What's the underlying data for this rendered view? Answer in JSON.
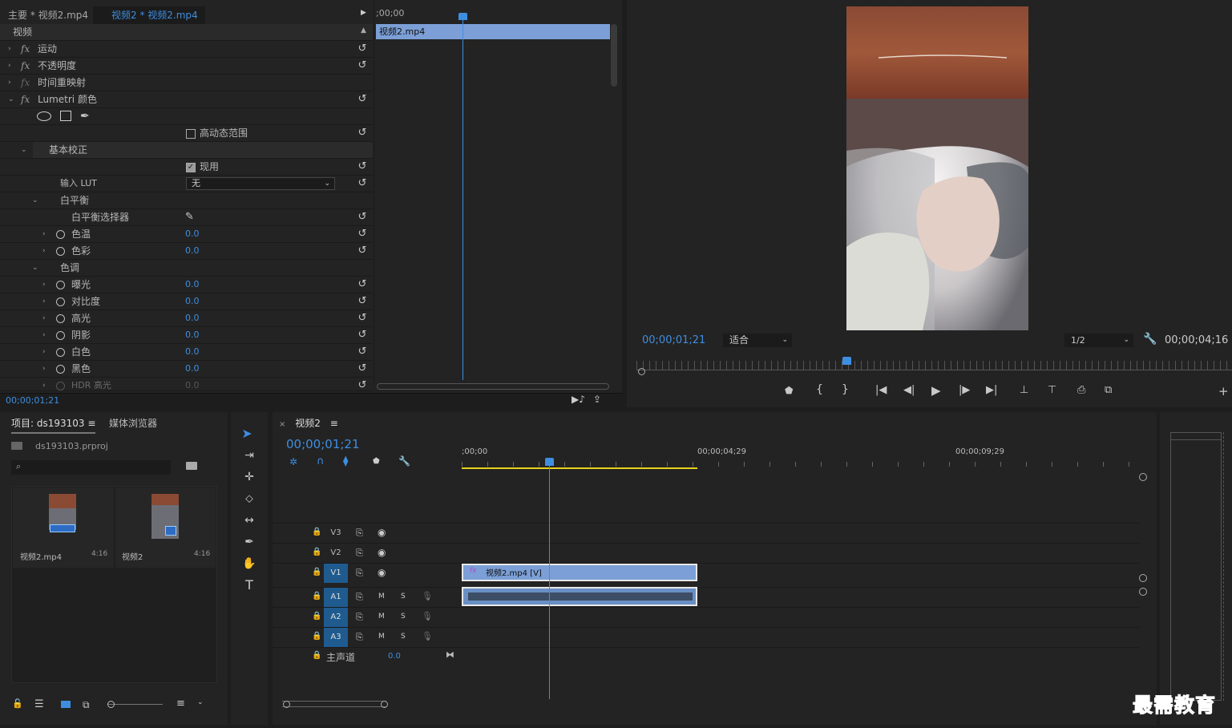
{
  "effect_controls": {
    "tab_master": "主要 * 视频2.mp4",
    "tab_clip": "视频2 * 视频2.mp4",
    "section_video": "视频",
    "timecode_start": ";00;00",
    "clip_label": "视频2.mp4",
    "rows": [
      {
        "label": "运动",
        "fx": "fx"
      },
      {
        "label": "不透明度",
        "fx": "fx"
      },
      {
        "label": "时间重映射",
        "fx": "fx"
      },
      {
        "label": "Lumetri 颜色",
        "fx": "fx"
      }
    ],
    "hdr_label": "高动态范围",
    "basic_correction": "基本校正",
    "enable_label": "现用",
    "input_lut_label": "输入 LUT",
    "input_lut_value": "无",
    "white_balance": "白平衡",
    "wb_picker": "白平衡选择器",
    "temperature": "色温",
    "temperature_value": "0.0",
    "tint": "色彩",
    "tint_value": "0.0",
    "tone": "色调",
    "tone_rows": [
      {
        "label": "曝光",
        "value": "0.0"
      },
      {
        "label": "对比度",
        "value": "0.0"
      },
      {
        "label": "高光",
        "value": "0.0"
      },
      {
        "label": "阴影",
        "value": "0.0"
      },
      {
        "label": "白色",
        "value": "0.0"
      },
      {
        "label": "黑色",
        "value": "0.0"
      }
    ],
    "hdr_highlight": "HDR 高光",
    "hdr_highlight_value": "0.0",
    "footer_timecode": "00;00;01;21"
  },
  "program": {
    "current_time": "00;00;01;21",
    "fit_label": "适合",
    "resolution": "1/2",
    "duration": "00;00;04;16",
    "playhead_fraction": 0.36
  },
  "project": {
    "tab_project": "项目: ds193103",
    "tab_media": "媒体浏览器",
    "file_name": "ds193103.prproj",
    "search_placeholder": "",
    "items": [
      {
        "name": "视频2.mp4",
        "duration": "4:16"
      },
      {
        "name": "视频2",
        "duration": "4:16"
      }
    ]
  },
  "timeline": {
    "tab": "视频2",
    "current_time": "00;00;01;21",
    "ruler": [
      ";00;00",
      "00;00;04;29",
      "00;00;09;29"
    ],
    "video_tracks": [
      "V3",
      "V2",
      "V1"
    ],
    "audio_tracks": [
      "A1",
      "A2",
      "A3"
    ],
    "master_label": "主声道",
    "master_value": "0.0",
    "video_clip_label": "视频2.mp4 [V]",
    "mute": "M",
    "solo": "S"
  },
  "watermark": "最需教育",
  "colors": {
    "accent": "#3e8ee0",
    "clip_video": "#7b9fd6",
    "clip_audio": "#6a8fc4",
    "workarea": "#e6d21a"
  }
}
